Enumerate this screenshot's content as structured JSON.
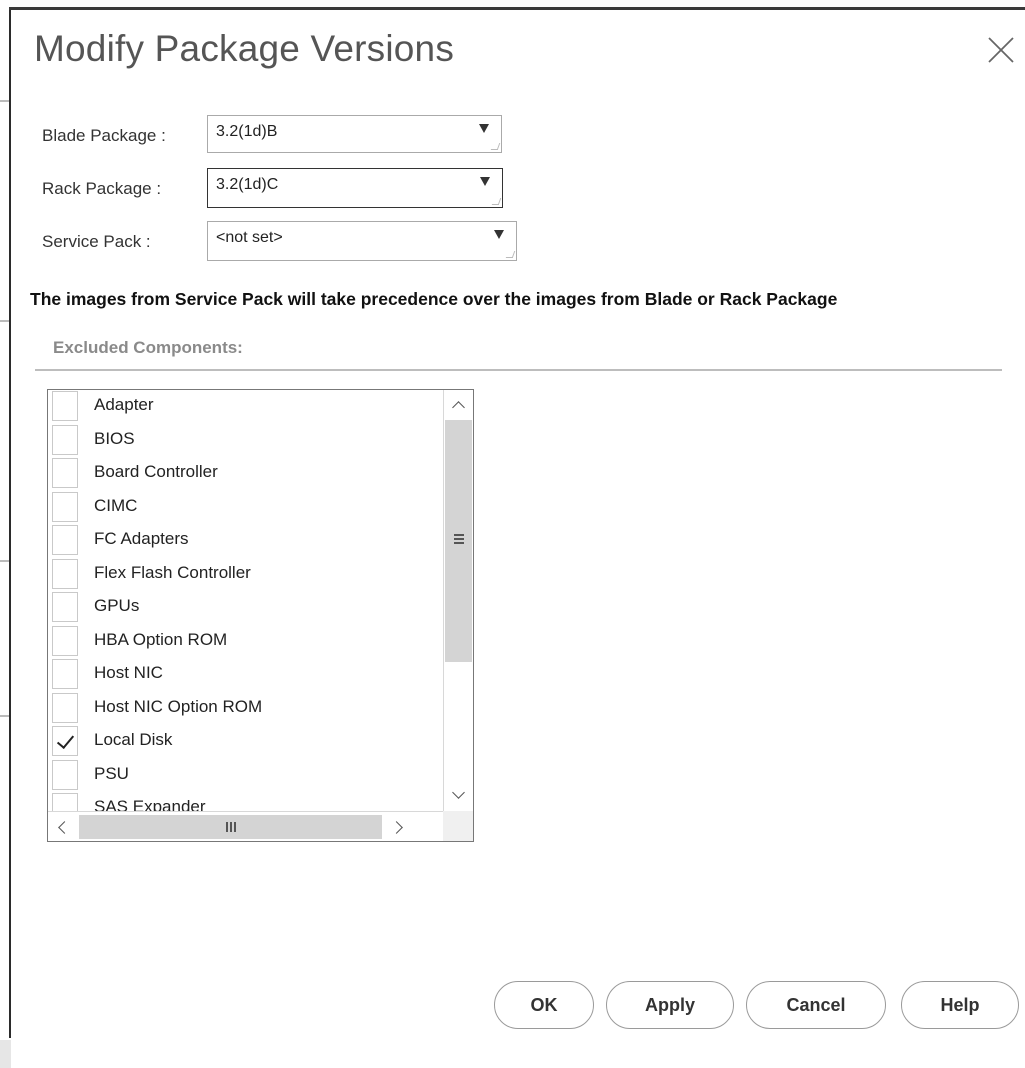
{
  "dialog": {
    "title": "Modify Package Versions"
  },
  "form": {
    "blade": {
      "label": "Blade Package :",
      "value": "3.2(1d)B"
    },
    "rack": {
      "label": "Rack Package  :",
      "value": "3.2(1d)C"
    },
    "service": {
      "label": "Service Pack   :",
      "value": "<not set>"
    }
  },
  "note": "The images from Service Pack will take precedence over the images from Blade or Rack Package",
  "excluded": {
    "heading": "Excluded Components:",
    "items": [
      {
        "label": "Adapter",
        "checked": false
      },
      {
        "label": "BIOS",
        "checked": false
      },
      {
        "label": "Board Controller",
        "checked": false
      },
      {
        "label": "CIMC",
        "checked": false
      },
      {
        "label": "FC Adapters",
        "checked": false
      },
      {
        "label": "Flex Flash Controller",
        "checked": false
      },
      {
        "label": "GPUs",
        "checked": false
      },
      {
        "label": "HBA Option ROM",
        "checked": false
      },
      {
        "label": "Host NIC",
        "checked": false
      },
      {
        "label": "Host NIC Option ROM",
        "checked": false
      },
      {
        "label": "Local Disk",
        "checked": true
      },
      {
        "label": "PSU",
        "checked": false
      },
      {
        "label": "SAS Expander",
        "checked": false
      }
    ]
  },
  "buttons": {
    "ok": "OK",
    "apply": "Apply",
    "cancel": "Cancel",
    "help": "Help"
  },
  "icons": {
    "close": "close-icon",
    "dropdown": "dropdown-arrow-icon",
    "check": "checkmark-icon"
  }
}
